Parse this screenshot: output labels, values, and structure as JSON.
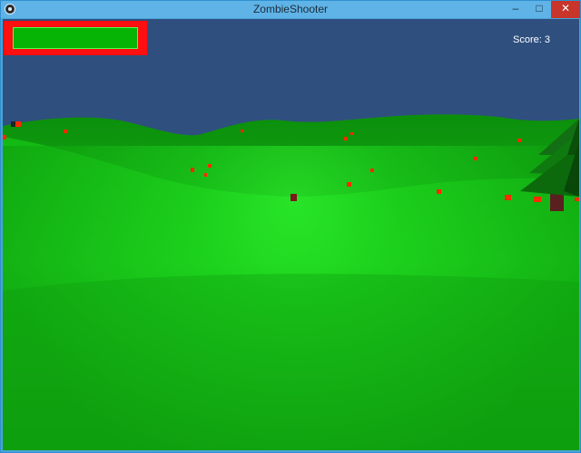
{
  "window": {
    "title": "ZombieShooter",
    "minimize_symbol": "–",
    "maximize_symbol": "□",
    "close_symbol": "✕"
  },
  "icons": {
    "app_icon": "unity-logo-icon"
  },
  "hud": {
    "health_fraction": 1.0,
    "score_text": "Score: 3"
  },
  "colors": {
    "sky": "#2f4f7f",
    "grass_light": "#2ee82e",
    "grass_dark": "#0a8a0a",
    "zombie": "#ff2a00",
    "health_frame": "#ff0f0f",
    "health_fill": "#06b406",
    "tree_leaves": "#0f7a0f",
    "tree_trunk": "#5a1f1f"
  }
}
